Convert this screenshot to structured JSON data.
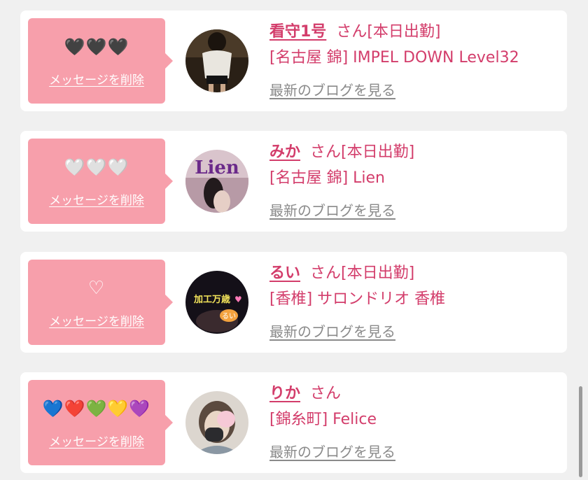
{
  "favorites": [
    {
      "emoji": "🖤🖤🖤",
      "delete_label": "メッセージを削除",
      "name": "看守1号",
      "suffix": "さん[本日出勤]",
      "shop": "[名古屋 錦] IMPEL DOWN Level32",
      "blog_label": "最新のブログを見る"
    },
    {
      "emoji": "🤍🤍🤍",
      "delete_label": "メッセージを削除",
      "name": "みか",
      "suffix": "さん[本日出勤]",
      "shop": "[名古屋 錦] Lien",
      "blog_label": "最新のブログを見る",
      "avatar_text": "Lien"
    },
    {
      "emoji": "♡",
      "delete_label": "メッセージを削除",
      "name": "るい",
      "suffix": "さん[本日出勤]",
      "shop": "[香椎] サロンドリオ 香椎",
      "blog_label": "最新のブログを見る",
      "avatar_text": "加工万歳",
      "avatar_subtext": "るい"
    },
    {
      "emoji": "💙❤️💚💛💜",
      "delete_label": "メッセージを削除",
      "name": "りか",
      "suffix": "さん",
      "shop": "[錦糸町] Felice",
      "blog_label": "最新のブログを見る"
    }
  ],
  "colors": {
    "bubble": "#f79fab",
    "accent": "#d33d6b",
    "link_gray": "#8a8a8a",
    "page_bg": "#f0f0f0"
  }
}
